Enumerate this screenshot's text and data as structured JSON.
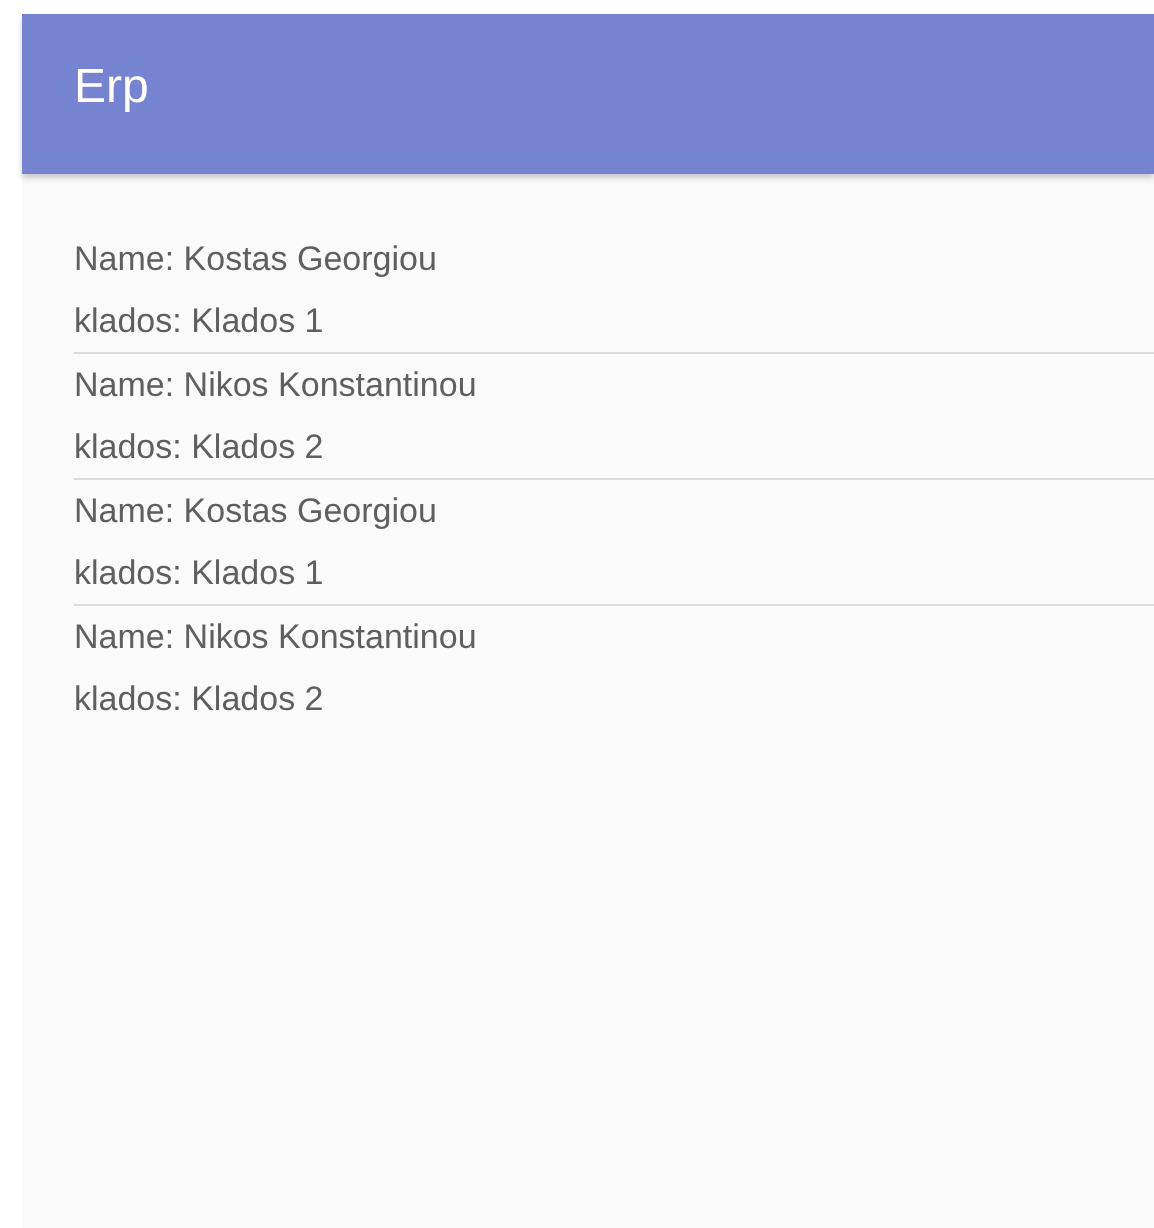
{
  "app_bar": {
    "title": "Erp"
  },
  "items": [
    {
      "name": "Name: Kostas Georgiou",
      "klados": "klados: Klados 1"
    },
    {
      "name": "Name: Nikos Konstantinou",
      "klados": "klados: Klados 2"
    },
    {
      "name": "Name: Kostas Georgiou",
      "klados": "klados: Klados 1"
    },
    {
      "name": "Name: Nikos Konstantinou",
      "klados": "klados: Klados 2"
    }
  ]
}
